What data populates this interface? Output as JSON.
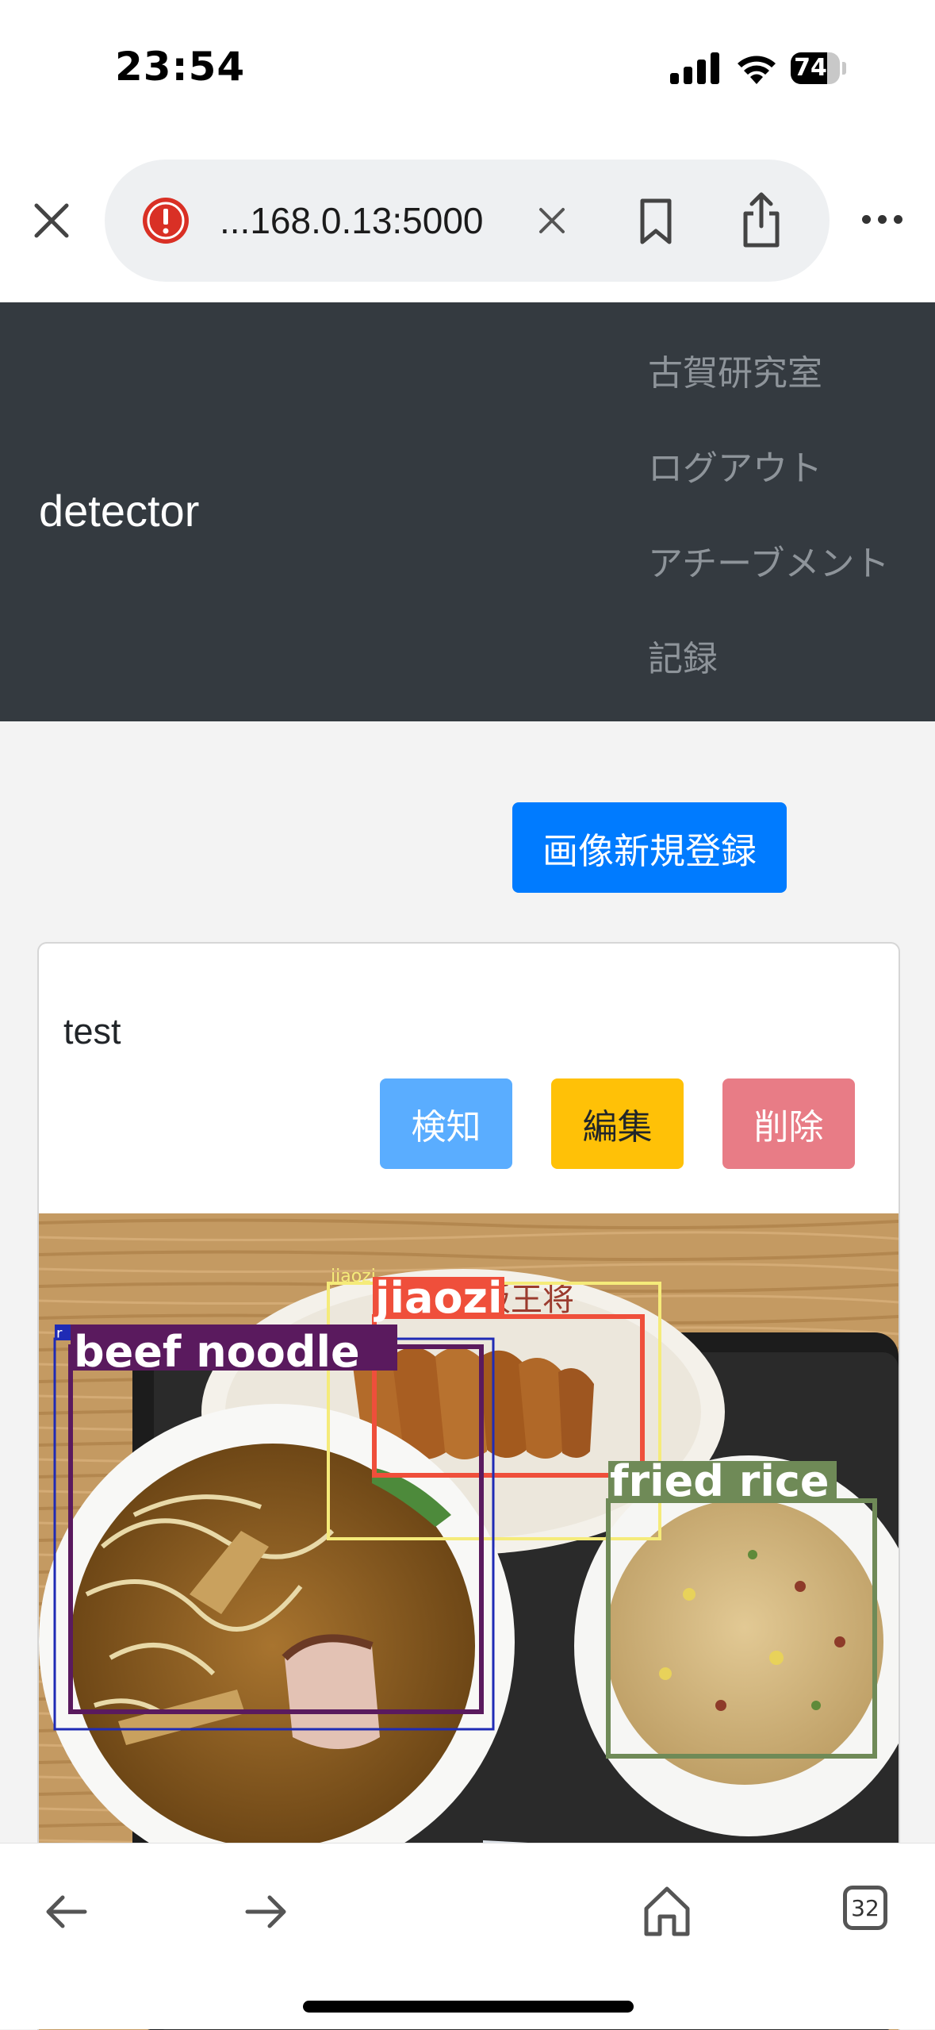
{
  "status_bar": {
    "time": "23:54",
    "battery": "74",
    "battery_level": 0.74
  },
  "browser": {
    "url": "...168.0.13:5000",
    "tab_count": "32",
    "icons": {
      "close": "close-icon",
      "alert": "alert-icon",
      "clear": "clear-icon",
      "bookmark": "bookmark-icon",
      "share": "share-icon",
      "more": "more-icon",
      "back": "back-arrow-icon",
      "forward": "forward-arrow-icon",
      "home": "home-icon",
      "tabs": "tabs-icon"
    }
  },
  "navbar": {
    "brand": "detector",
    "items": [
      {
        "label": "古賀研究室"
      },
      {
        "label": "ログアウト"
      },
      {
        "label": "アチーブメント"
      },
      {
        "label": "記録"
      }
    ]
  },
  "main": {
    "new_image_label": "画像新規登録",
    "card": {
      "title": "test",
      "buttons": {
        "detect": "検知",
        "edit": "編集",
        "delete": "削除"
      },
      "detections": [
        {
          "label": "jiaozi",
          "color": "#f5eb7a"
        },
        {
          "label": "jiaozi",
          "color": "#ef4f3b"
        },
        {
          "label": "beef noodle",
          "color": "#5a1a5e"
        },
        {
          "label": "r",
          "color": "#1f2bb5"
        },
        {
          "label": "fried rice",
          "color": "#6f8a57"
        }
      ]
    }
  },
  "colors": {
    "navbar_bg": "#343a40",
    "primary": "#007bff",
    "info": "#5aadff",
    "warning": "#ffc107",
    "danger": "#e87c86",
    "page_bg": "#f3f3f3"
  }
}
